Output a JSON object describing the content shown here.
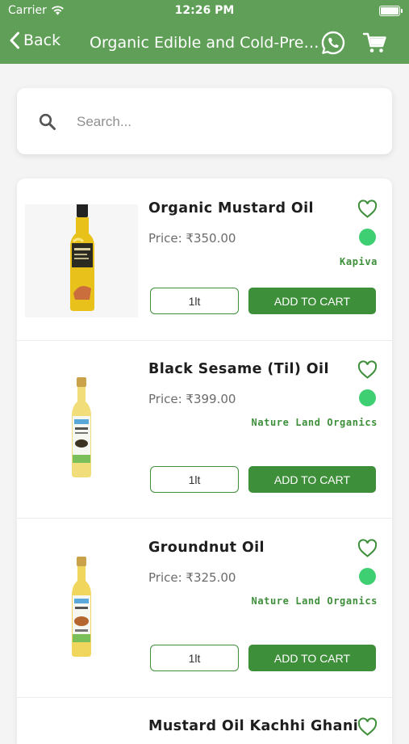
{
  "status_bar": {
    "carrier": "Carrier",
    "time": "12:26 PM"
  },
  "nav": {
    "back_label": "Back",
    "title": "Organic Edible and Cold-Pressed Oils"
  },
  "search": {
    "placeholder": "Search..."
  },
  "colors": {
    "header": "#5f9f57",
    "primary": "#3e8f3a",
    "indicator": "#3ecf72"
  },
  "products": [
    {
      "name": "Organic Mustard Oil",
      "price": "Price: ₹350.00",
      "brand": "Kapiva",
      "size": "1lt",
      "cart_label": "ADD TO CART"
    },
    {
      "name": "Black Sesame (Til) Oil",
      "price": "Price: ₹399.00",
      "brand": "Nature Land Organics",
      "size": "1lt",
      "cart_label": "ADD TO CART"
    },
    {
      "name": "Groundnut Oil",
      "price": "Price: ₹325.00",
      "brand": "Nature Land Organics",
      "size": "1lt",
      "cart_label": "ADD TO CART"
    },
    {
      "name": "Mustard Oil Kachhi Ghani"
    }
  ]
}
